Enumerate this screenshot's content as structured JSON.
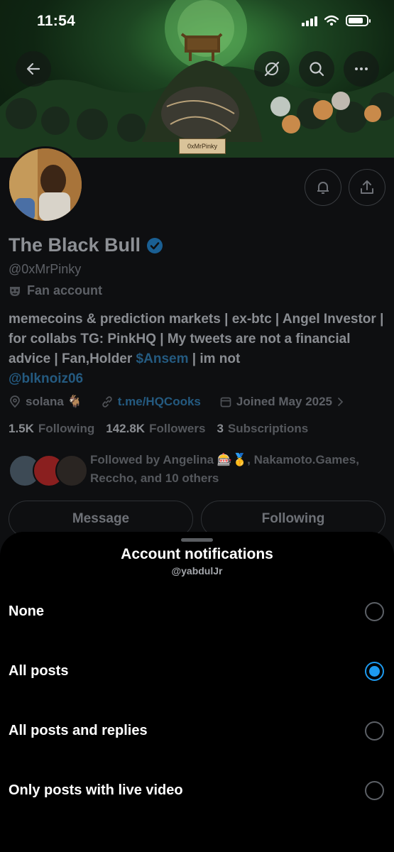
{
  "status_bar": {
    "time": "11:54",
    "battery_percent": 85
  },
  "profile": {
    "banner_tag": "0xMrPinky",
    "name": "The Black Bull",
    "handle": "@0xMrPinky",
    "badge": "Fan account",
    "bio_parts": {
      "main": "memecoins & prediction markets | ex-btc | Angel Investor | for collabs TG: PinkHQ | My tweets are not a financial advice | Fan,Holder ",
      "cashtag": "$Ansem",
      "mid": " | im not ",
      "mention": "@blknoiz06"
    },
    "location": "solana 🐐",
    "website": "t.me/HQCooks",
    "joined": "Joined May 2025",
    "following_count": "1.5K",
    "following_label": "Following",
    "followers_count": "142.8K",
    "followers_label": "Followers",
    "subscriptions_count": "3",
    "subscriptions_label": "Subscriptions",
    "followed_by": "Followed by Angelina 🎰🥇, Nakamoto.Games, Reccho, and 10 others",
    "message_label": "Message",
    "following_button_label": "Following"
  },
  "sheet": {
    "title": "Account notifications",
    "subtitle": "@yabdulJr",
    "options": [
      {
        "label": "None",
        "selected": false
      },
      {
        "label": "All posts",
        "selected": true
      },
      {
        "label": "All posts and replies",
        "selected": false
      },
      {
        "label": "Only posts with live video",
        "selected": false
      }
    ]
  },
  "colors": {
    "accent": "#1d9bf0",
    "verified": "#1d9bf0",
    "sheet_bg": "#000000"
  }
}
